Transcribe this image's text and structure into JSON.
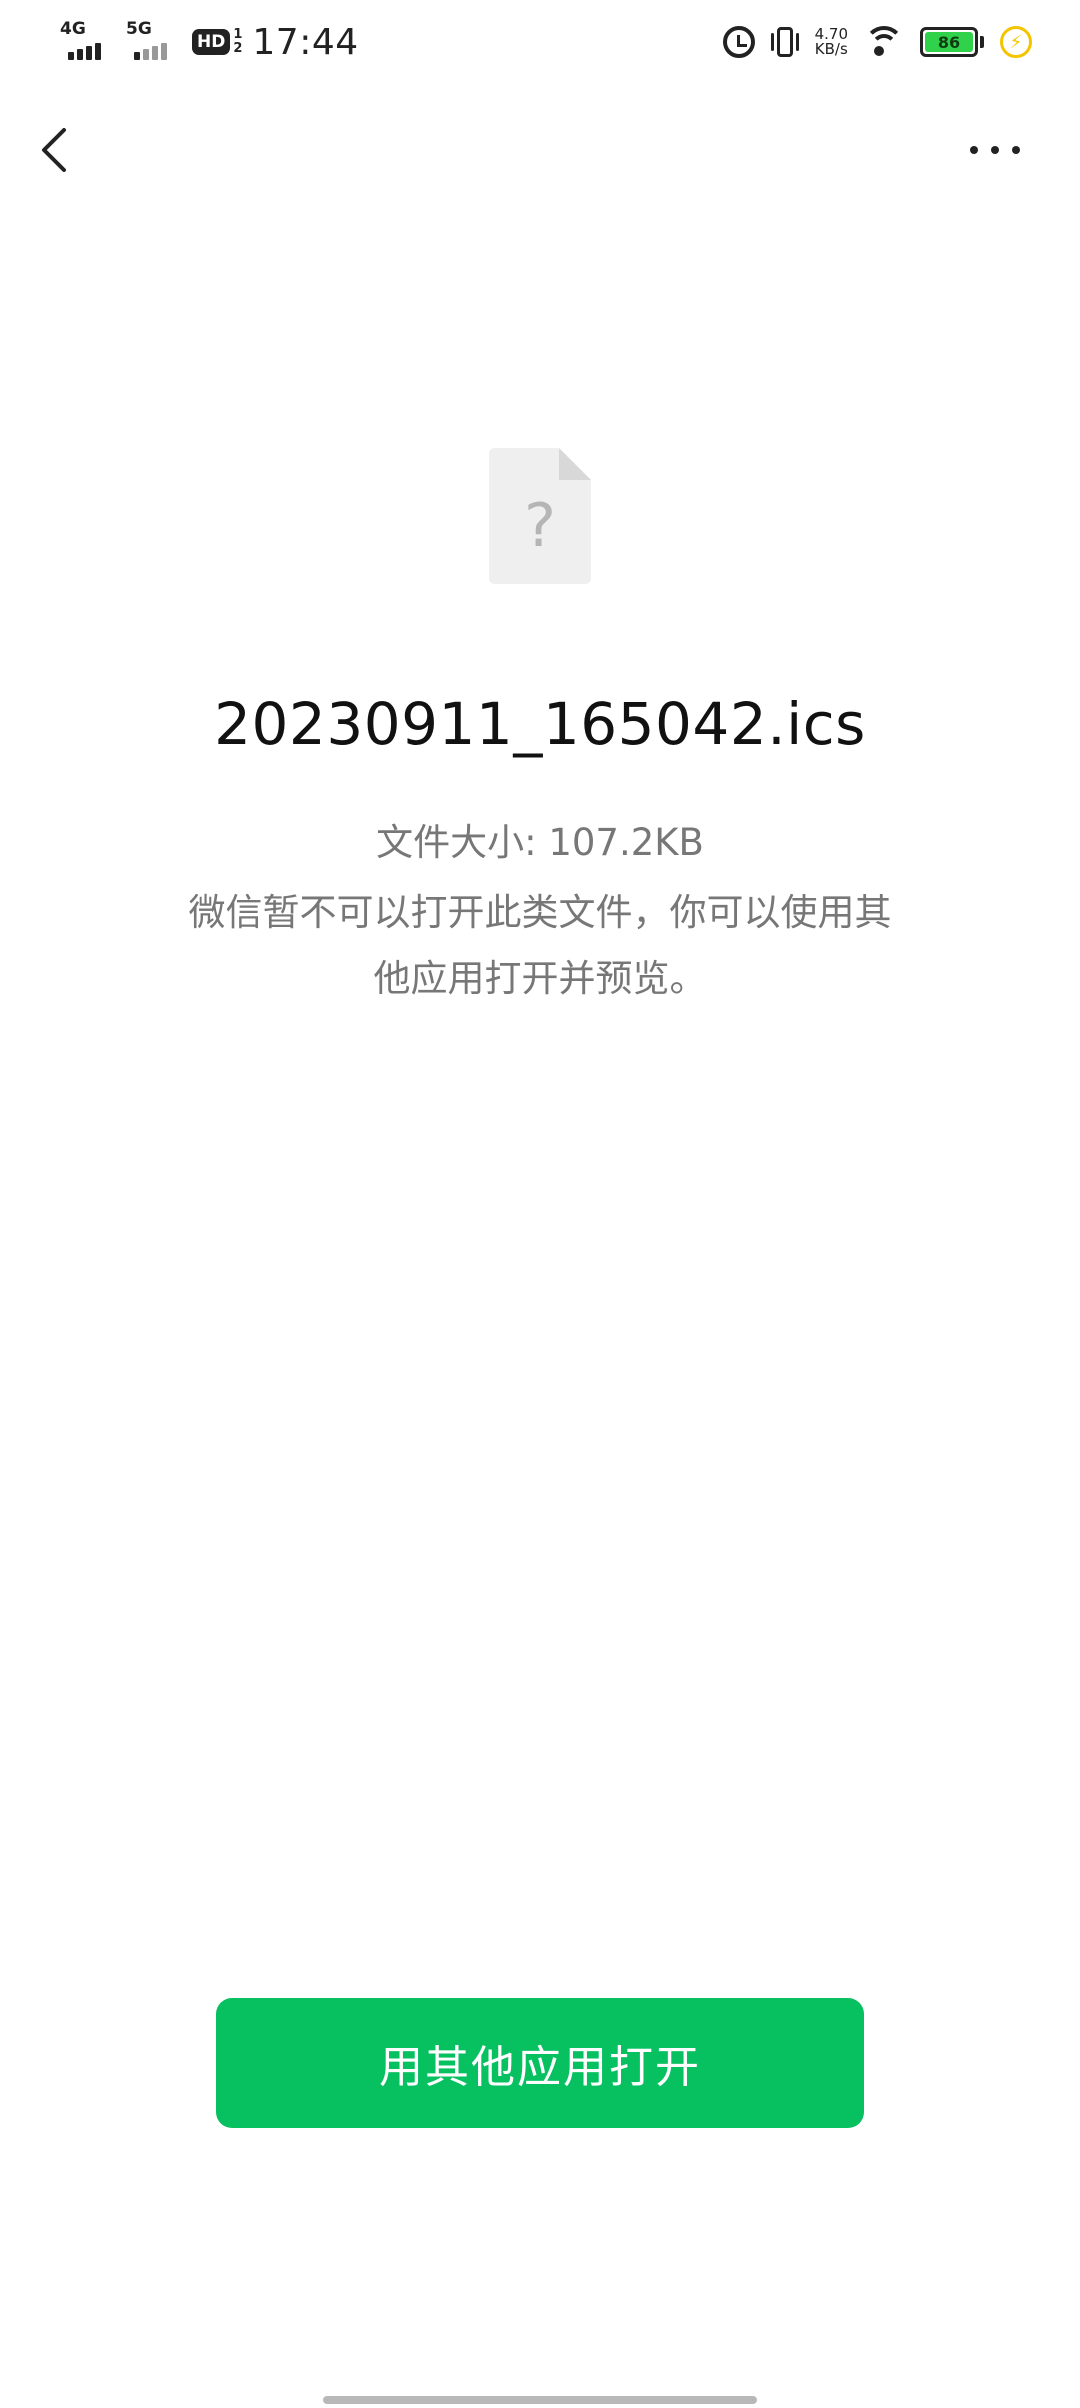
{
  "status_bar": {
    "sim1_network": "4G",
    "sim2_network": "5G",
    "hd_label": "HD",
    "hd_sub_top": "1",
    "hd_sub_bottom": "2",
    "time": "17:44",
    "net_speed_value": "4.70",
    "net_speed_unit": "KB/s",
    "battery_level": "86",
    "battery_color": "#2fd24a",
    "icons": [
      "alarm-icon",
      "vibrate-icon",
      "wifi-icon",
      "battery-icon",
      "charging-icon"
    ]
  },
  "navbar": {
    "back_icon": "chevron-left-icon",
    "more_icon": "more-dots-icon"
  },
  "file": {
    "icon": "unknown-file-icon",
    "icon_glyph": "?",
    "name": "20230911_165042.ics",
    "size_label": "文件大小: 107.2KB",
    "description_line1": "微信暂不可以打开此类文件，你可以使用其",
    "description_line2": "他应用打开并预览。"
  },
  "actions": {
    "open_with_other_app": "用其他应用打开",
    "accent_color": "#07c160"
  }
}
